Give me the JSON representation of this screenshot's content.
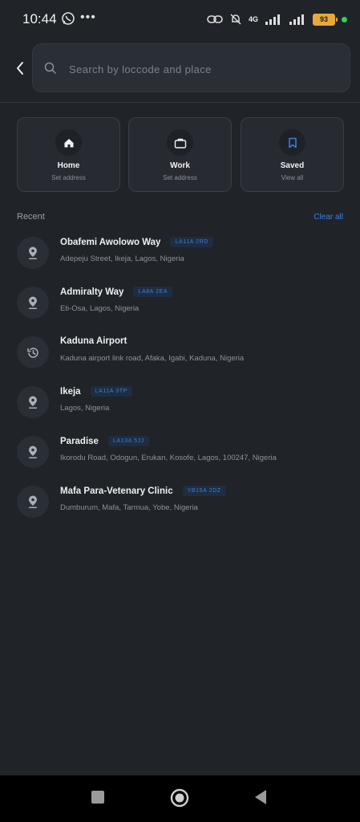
{
  "status_bar": {
    "time": "10:44",
    "network": "4G",
    "battery": "93"
  },
  "search": {
    "placeholder": "Search by loccode and place"
  },
  "shortcuts": [
    {
      "label": "Home",
      "sub": "Set address",
      "icon": "home-icon"
    },
    {
      "label": "Work",
      "sub": "Set address",
      "icon": "briefcase-icon"
    },
    {
      "label": "Saved",
      "sub": "View all",
      "icon": "bookmark-icon"
    }
  ],
  "recent": {
    "title": "Recent",
    "clear_label": "Clear all",
    "items": [
      {
        "title": "Obafemi Awolowo Way",
        "code": "LA11A 2RD",
        "address": "Adepeju Street, Ikeja, Lagos, Nigeria",
        "icon": "location-pin-icon"
      },
      {
        "title": "Admiralty Way",
        "code": "LA8A 2EA",
        "address": "Eti-Osa, Lagos, Nigeria",
        "icon": "location-pin-icon"
      },
      {
        "title": "Kaduna Airport",
        "code": "",
        "address": "Kaduna airport link road, Afaka, Igabi, Kaduna, Nigeria",
        "icon": "history-icon"
      },
      {
        "title": "Ikeja",
        "code": "LA11A 3TP",
        "address": "Lagos, Nigeria",
        "icon": "location-pin-icon"
      },
      {
        "title": "Paradise",
        "code": "LA13A 5JJ",
        "address": "Ikorodu Road, Odogun, Erukan, Kosofe, Lagos, 100247, Nigeria",
        "icon": "location-pin-icon"
      },
      {
        "title": "Mafa Para-Vetenary Clinic",
        "code": "YB15A 2DZ",
        "address": "Dumburum, Mafa, Tarmua, Yobe, Nigeria",
        "icon": "location-pin-icon"
      }
    ]
  },
  "colors": {
    "background": "#202328",
    "accent": "#3d7fe0",
    "card": "#272a31"
  }
}
